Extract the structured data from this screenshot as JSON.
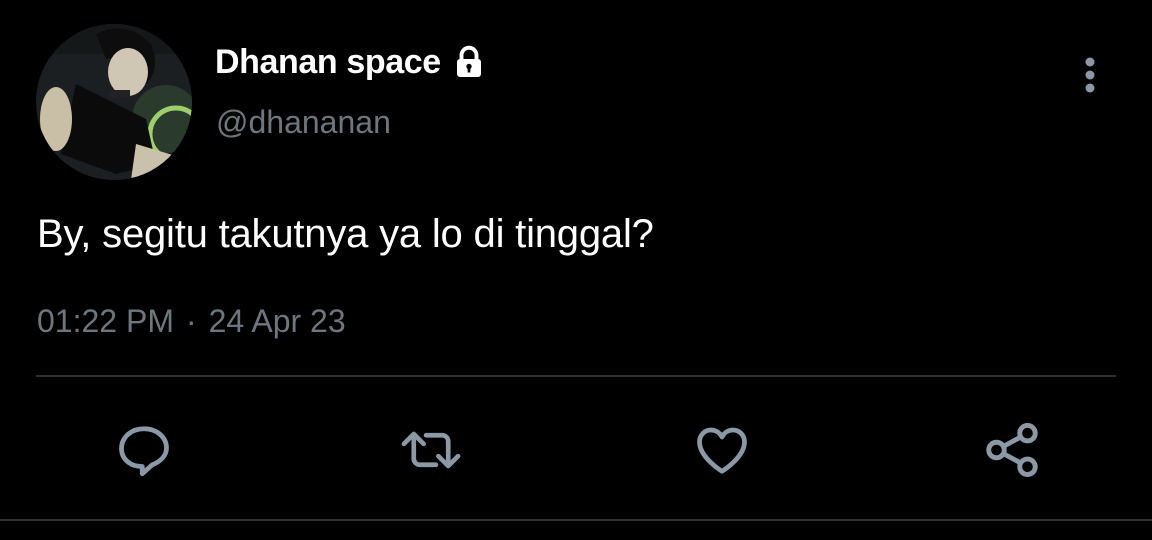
{
  "tweet": {
    "display_name": "Dhanan space",
    "handle": "@dhananan",
    "text": "By, segitu takutnya ya lo di tinggal?",
    "time": "01:22 PM",
    "separator": "·",
    "date": "24 Apr 23",
    "protected": true
  },
  "icons": {
    "lock": "lock-icon",
    "more": "more-vertical-icon",
    "reply": "reply-icon",
    "retweet": "retweet-icon",
    "like": "heart-icon",
    "share": "share-icon"
  },
  "colors": {
    "background": "#000000",
    "primary_text": "#ffffff",
    "secondary_text": "#6e767d",
    "icon": "#8b98a5",
    "divider": "#2f3336"
  }
}
